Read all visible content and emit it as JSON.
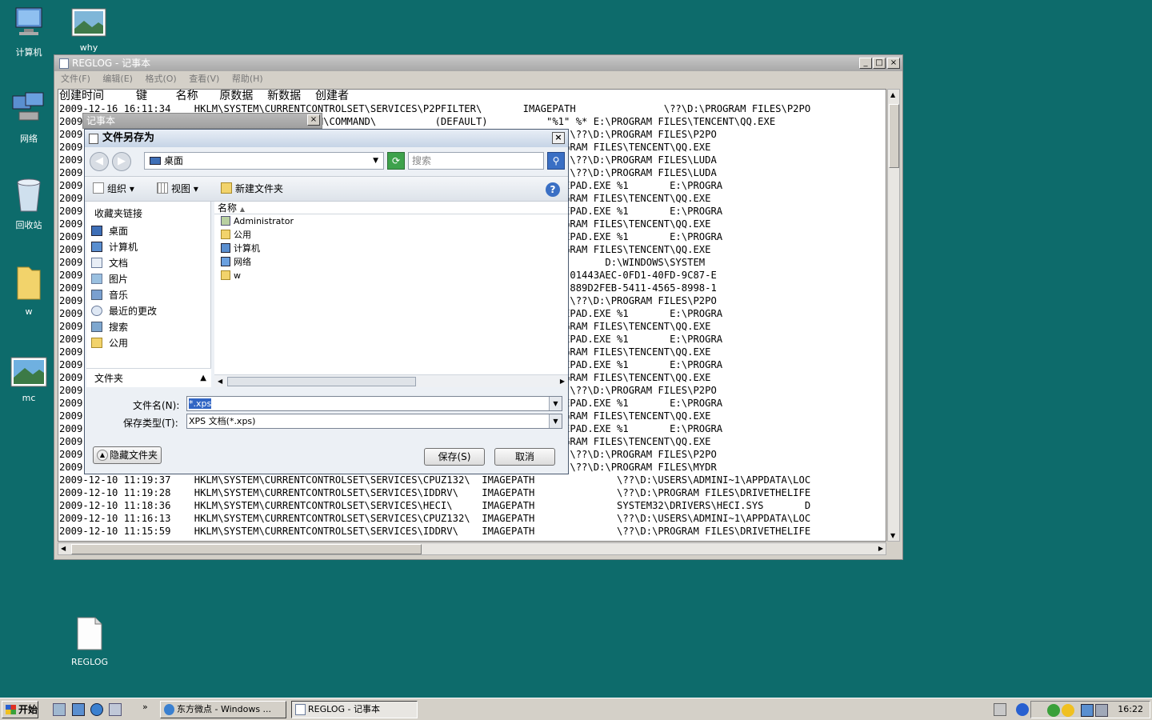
{
  "desktop": {
    "icons": [
      {
        "label": "计算机"
      },
      {
        "label": "why"
      },
      {
        "label": "网络"
      },
      {
        "label": "回收站"
      },
      {
        "label": "w"
      },
      {
        "label": "mc"
      },
      {
        "label": "REGLOG"
      }
    ]
  },
  "notepad": {
    "title": "REGLOG - 记事本",
    "menu": [
      "文件(F)",
      "编辑(E)",
      "格式(O)",
      "查看(V)",
      "帮助(H)"
    ],
    "header": "创建时间         键        名称      原数据    新数据    创建者",
    "lines": [
      "2009-12-16 16:11:34    HKLM\\SYSTEM\\CURRENTCONTROLSET\\SERVICES\\P2PFILTER\\       IMAGEPATH               \\??\\D:\\PROGRAM FILES\\P2PO",
      "2009                                    \\OPEN\\COMMAND\\          (DEFAULT)          \"%1\" %* E:\\PROGRAM FILES\\TENCENT\\QQ.EXE",
      "2009                                                           IMAGEPATH               \\??\\D:\\PROGRAM FILES\\P2PO",
      "2009                                                                    \"%1\" %* E:\\PROGRAM FILES\\TENCENT\\QQ.EXE",
      "2009                                                           IMAGEPATH               \\??\\D:\\PROGRAM FILES\\LUDA",
      "2009                                                           IMAGEPATH               \\??\\D:\\PROGRAM FILES\\LUDA",
      "2009                                                                    D:\\WINDOWS\\NOTEPAD.EXE %1       E:\\PROGRA",
      "2009                                                                    \"%1\" %* E:\\PROGRAM FILES\\TENCENT\\QQ.EXE",
      "2009                                                                    D:\\WINDOWS\\NOTEPAD.EXE %1       E:\\PROGRA",
      "2009                                                                    \"%1\" %* E:\\PROGRAM FILES\\TENCENT\\QQ.EXE",
      "2009                                                                    D:\\WINDOWS\\NOTEPAD.EXE %1       E:\\PROGRA",
      "2009                                                                    \"%1\" %* E:\\PROGRAM FILES\\TENCENT\\QQ.EXE",
      "2009                                                           FLASHPLAYERUPDATE             D:\\WINDOWS\\SYSTEM",
      "2009                                                           BROWSER HELPER OBJECTS\\{01443AEC-0FD1-40FD-9C87-E",
      "2009                                                           BROWSER HELPER OBJECTS\\{889D2FEB-5411-4565-8998-1",
      "2009                                                           IMAGEPATH               \\??\\D:\\PROGRAM FILES\\P2PO",
      "2009                                                                    D:\\WINDOWS\\NOTEPAD.EXE %1       E:\\PROGRA",
      "2009                                                                    \"%1\" %* E:\\PROGRAM FILES\\TENCENT\\QQ.EXE",
      "2009                                                                    D:\\WINDOWS\\NOTEPAD.EXE %1       E:\\PROGRA",
      "2009                                                                    \"%1\" %* E:\\PROGRAM FILES\\TENCENT\\QQ.EXE",
      "2009                                                                    D:\\WINDOWS\\NOTEPAD.EXE %1       E:\\PROGRA",
      "2009                                                                    \"%1\" %* E:\\PROGRAM FILES\\TENCENT\\QQ.EXE",
      "2009                                                           IMAGEPATH               \\??\\D:\\PROGRAM FILES\\P2PO",
      "2009                                                                    D:\\WINDOWS\\NOTEPAD.EXE %1       E:\\PROGRA",
      "2009                                                                    \"%1\" %* E:\\PROGRAM FILES\\TENCENT\\QQ.EXE",
      "2009                                                                    D:\\WINDOWS\\NOTEPAD.EXE %1       E:\\PROGRA",
      "2009                                                                    \"%1\" %* E:\\PROGRAM FILES\\TENCENT\\QQ.EXE",
      "2009                                                           IMAGEPATH               \\??\\D:\\PROGRAM FILES\\P2PO",
      "2009                                                           IMAGEPATH               \\??\\D:\\PROGRAM FILES\\MYDR",
      "2009-12-10 11:19:37    HKLM\\SYSTEM\\CURRENTCONTROLSET\\SERVICES\\CPUZ132\\  IMAGEPATH              \\??\\D:\\USERS\\ADMINI~1\\APPDATA\\LOC",
      "2009-12-10 11:19:28    HKLM\\SYSTEM\\CURRENTCONTROLSET\\SERVICES\\IDDRV\\    IMAGEPATH              \\??\\D:\\PROGRAM FILES\\DRIVETHELIFE",
      "2009-12-10 11:18:36    HKLM\\SYSTEM\\CURRENTCONTROLSET\\SERVICES\\HECI\\     IMAGEPATH              SYSTEM32\\DRIVERS\\HECI.SYS       D",
      "2009-12-10 11:16:13    HKLM\\SYSTEM\\CURRENTCONTROLSET\\SERVICES\\CPUZ132\\  IMAGEPATH              \\??\\D:\\USERS\\ADMINI~1\\APPDATA\\LOC",
      "2009-12-10 11:15:59    HKLM\\SYSTEM\\CURRENTCONTROLSET\\SERVICES\\IDDRV\\    IMAGEPATH              \\??\\D:\\PROGRAM FILES\\DRIVETHELIFE"
    ]
  },
  "notepad_small": {
    "title": "记事本"
  },
  "save_dialog": {
    "title": "文件另存为",
    "address": "桌面",
    "search_placeholder": "搜索",
    "toolbar": {
      "organize": "组织",
      "views": "视图",
      "new_folder": "新建文件夹"
    },
    "favorites_header": "收藏夹链接",
    "favorites": [
      "桌面",
      "计算机",
      "文档",
      "图片",
      "音乐",
      "最近的更改",
      "搜索",
      "公用"
    ],
    "folders_label": "文件夹",
    "column_name": "名称",
    "files": [
      "Administrator",
      "公用",
      "计算机",
      "网络",
      "w"
    ],
    "filename_label": "文件名(N):",
    "filename_value": "*.xps",
    "filetype_label": "保存类型(T):",
    "filetype_value": "XPS 文档(*.xps)",
    "hide_folders": "隐藏文件夹",
    "save_button": "保存(S)",
    "cancel_button": "取消"
  },
  "taskbar": {
    "start": "开始",
    "tasks": [
      "东方微点 - Windows ...",
      "REGLOG - 记事本"
    ],
    "clock": "16:22"
  }
}
